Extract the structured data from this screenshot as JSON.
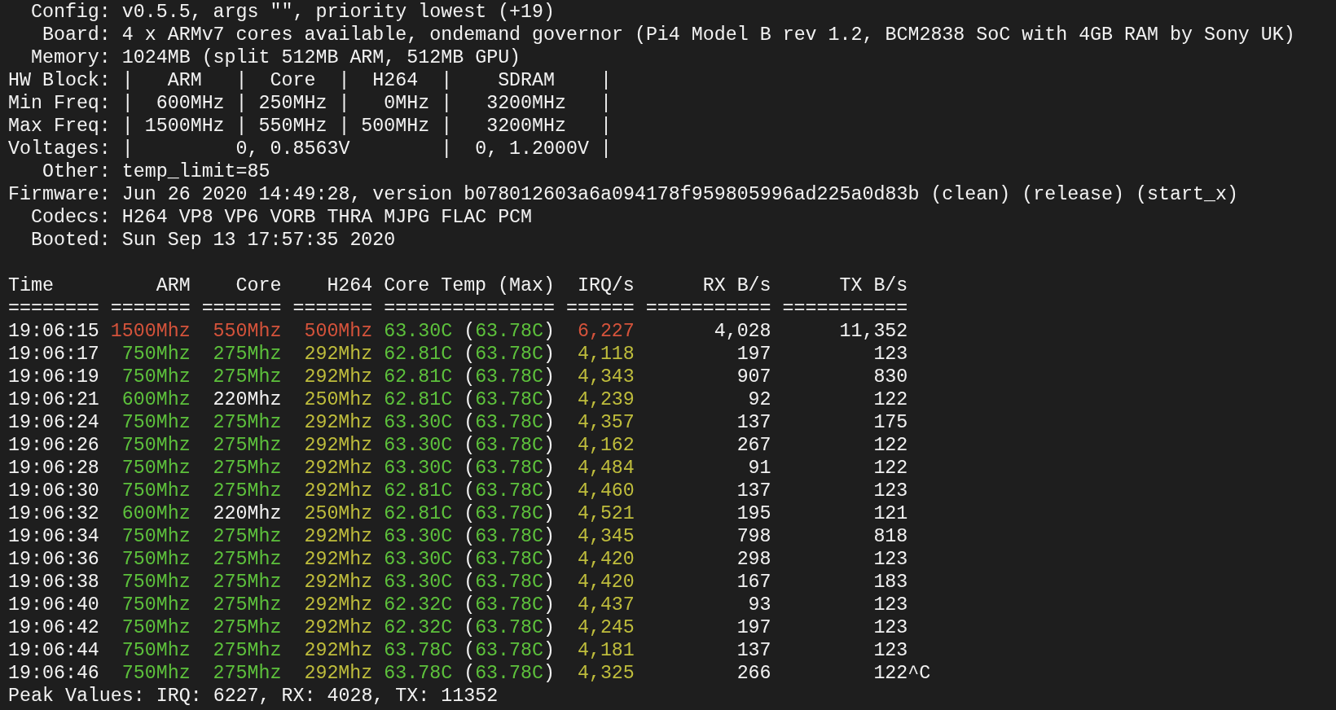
{
  "info_lines": [
    {
      "label": "Config:",
      "value": "v0.5.5, args \"\", priority lowest (+19)"
    },
    {
      "label": "Board:",
      "value": "4 x ARMv7 cores available, ondemand governor (Pi4 Model B rev 1.2, BCM2838 SoC with 4GB RAM by Sony UK)"
    },
    {
      "label": "Memory:",
      "value": "1024MB (split 512MB ARM, 512MB GPU)"
    },
    {
      "label": "HW Block:",
      "value": "|   ARM   |  Core  |  H264  |    SDRAM    |"
    },
    {
      "label": "Min Freq:",
      "value": "|  600MHz | 250MHz |   0MHz |   3200MHz   |"
    },
    {
      "label": "Max Freq:",
      "value": "| 1500MHz | 550MHz | 500MHz |   3200MHz   |"
    },
    {
      "label": "Voltages:",
      "value": "|         0, 0.8563V        |  0, 1.2000V |"
    },
    {
      "label": "Other:",
      "value": "temp_limit=85"
    },
    {
      "label": "Firmware:",
      "value": "Jun 26 2020 14:49:28, version b078012603a6a094178f959805996ad225a0d83b (clean) (release) (start_x)"
    },
    {
      "label": "Codecs:",
      "value": "H264 VP8 VP6 VORB THRA MJPG FLAC PCM"
    },
    {
      "label": "Booted:",
      "value": "Sun Sep 13 17:57:35 2020"
    }
  ],
  "table": {
    "columns": [
      {
        "label": "Time",
        "rule": "========"
      },
      {
        "label": "ARM",
        "rule": "======="
      },
      {
        "label": "Core",
        "rule": "======="
      },
      {
        "label": "H264",
        "rule": "======="
      },
      {
        "label": "Core Temp (Max)",
        "rule": "==============="
      },
      {
        "label": "IRQ/s",
        "rule": "======"
      },
      {
        "label": "RX B/s",
        "rule": "==========="
      },
      {
        "label": "TX B/s",
        "rule": "==========="
      }
    ],
    "rows": [
      {
        "time": "19:06:15",
        "arm": {
          "text": "1500Mhz",
          "color": "#d5533b"
        },
        "core": {
          "text": "550Mhz",
          "color": "#d5533b"
        },
        "h264": {
          "text": "500Mhz",
          "color": "#d5533b"
        },
        "temp": {
          "text": "63.30C",
          "color": "#5dc13c"
        },
        "max": {
          "open": "(",
          "text": "63.78C",
          "close": ")",
          "color": "#5dc13c"
        },
        "irq": {
          "text": "6,227",
          "color": "#d5533b"
        },
        "rx": "4,028",
        "tx": "11,352"
      },
      {
        "time": "19:06:17",
        "arm": {
          "text": "750Mhz",
          "color": "#5dc13c"
        },
        "core": {
          "text": "275Mhz",
          "color": "#5dc13c"
        },
        "h264": {
          "text": "292Mhz",
          "color": "#bfbd3c"
        },
        "temp": {
          "text": "62.81C",
          "color": "#5dc13c"
        },
        "max": {
          "open": "(",
          "text": "63.78C",
          "close": ")",
          "color": "#5dc13c"
        },
        "irq": {
          "text": "4,118",
          "color": "#bfbd3c"
        },
        "rx": "197",
        "tx": "123"
      },
      {
        "time": "19:06:19",
        "arm": {
          "text": "750Mhz",
          "color": "#5dc13c"
        },
        "core": {
          "text": "275Mhz",
          "color": "#5dc13c"
        },
        "h264": {
          "text": "292Mhz",
          "color": "#bfbd3c"
        },
        "temp": {
          "text": "62.81C",
          "color": "#5dc13c"
        },
        "max": {
          "open": "(",
          "text": "63.78C",
          "close": ")",
          "color": "#5dc13c"
        },
        "irq": {
          "text": "4,343",
          "color": "#bfbd3c"
        },
        "rx": "907",
        "tx": "830"
      },
      {
        "time": "19:06:21",
        "arm": {
          "text": "600Mhz",
          "color": "#5dc13c"
        },
        "core": {
          "text": "220Mhz",
          "color": "#f2f2f2"
        },
        "h264": {
          "text": "250Mhz",
          "color": "#bfbd3c"
        },
        "temp": {
          "text": "62.81C",
          "color": "#5dc13c"
        },
        "max": {
          "open": "(",
          "text": "63.78C",
          "close": ")",
          "color": "#5dc13c"
        },
        "irq": {
          "text": "4,239",
          "color": "#bfbd3c"
        },
        "rx": "92",
        "tx": "122"
      },
      {
        "time": "19:06:24",
        "arm": {
          "text": "750Mhz",
          "color": "#5dc13c"
        },
        "core": {
          "text": "275Mhz",
          "color": "#5dc13c"
        },
        "h264": {
          "text": "292Mhz",
          "color": "#bfbd3c"
        },
        "temp": {
          "text": "63.30C",
          "color": "#5dc13c"
        },
        "max": {
          "open": "(",
          "text": "63.78C",
          "close": ")",
          "color": "#5dc13c"
        },
        "irq": {
          "text": "4,357",
          "color": "#bfbd3c"
        },
        "rx": "137",
        "tx": "175"
      },
      {
        "time": "19:06:26",
        "arm": {
          "text": "750Mhz",
          "color": "#5dc13c"
        },
        "core": {
          "text": "275Mhz",
          "color": "#5dc13c"
        },
        "h264": {
          "text": "292Mhz",
          "color": "#bfbd3c"
        },
        "temp": {
          "text": "63.30C",
          "color": "#5dc13c"
        },
        "max": {
          "open": "(",
          "text": "63.78C",
          "close": ")",
          "color": "#5dc13c"
        },
        "irq": {
          "text": "4,162",
          "color": "#bfbd3c"
        },
        "rx": "267",
        "tx": "122"
      },
      {
        "time": "19:06:28",
        "arm": {
          "text": "750Mhz",
          "color": "#5dc13c"
        },
        "core": {
          "text": "275Mhz",
          "color": "#5dc13c"
        },
        "h264": {
          "text": "292Mhz",
          "color": "#bfbd3c"
        },
        "temp": {
          "text": "63.30C",
          "color": "#5dc13c"
        },
        "max": {
          "open": "(",
          "text": "63.78C",
          "close": ")",
          "color": "#5dc13c"
        },
        "irq": {
          "text": "4,484",
          "color": "#bfbd3c"
        },
        "rx": "91",
        "tx": "122"
      },
      {
        "time": "19:06:30",
        "arm": {
          "text": "750Mhz",
          "color": "#5dc13c"
        },
        "core": {
          "text": "275Mhz",
          "color": "#5dc13c"
        },
        "h264": {
          "text": "292Mhz",
          "color": "#bfbd3c"
        },
        "temp": {
          "text": "62.81C",
          "color": "#5dc13c"
        },
        "max": {
          "open": "(",
          "text": "63.78C",
          "close": ")",
          "color": "#5dc13c"
        },
        "irq": {
          "text": "4,460",
          "color": "#bfbd3c"
        },
        "rx": "137",
        "tx": "123"
      },
      {
        "time": "19:06:32",
        "arm": {
          "text": "600Mhz",
          "color": "#5dc13c"
        },
        "core": {
          "text": "220Mhz",
          "color": "#f2f2f2"
        },
        "h264": {
          "text": "250Mhz",
          "color": "#bfbd3c"
        },
        "temp": {
          "text": "62.81C",
          "color": "#5dc13c"
        },
        "max": {
          "open": "(",
          "text": "63.78C",
          "close": ")",
          "color": "#5dc13c"
        },
        "irq": {
          "text": "4,521",
          "color": "#bfbd3c"
        },
        "rx": "195",
        "tx": "121"
      },
      {
        "time": "19:06:34",
        "arm": {
          "text": "750Mhz",
          "color": "#5dc13c"
        },
        "core": {
          "text": "275Mhz",
          "color": "#5dc13c"
        },
        "h264": {
          "text": "292Mhz",
          "color": "#bfbd3c"
        },
        "temp": {
          "text": "63.30C",
          "color": "#5dc13c"
        },
        "max": {
          "open": "(",
          "text": "63.78C",
          "close": ")",
          "color": "#5dc13c"
        },
        "irq": {
          "text": "4,345",
          "color": "#bfbd3c"
        },
        "rx": "798",
        "tx": "818"
      },
      {
        "time": "19:06:36",
        "arm": {
          "text": "750Mhz",
          "color": "#5dc13c"
        },
        "core": {
          "text": "275Mhz",
          "color": "#5dc13c"
        },
        "h264": {
          "text": "292Mhz",
          "color": "#bfbd3c"
        },
        "temp": {
          "text": "63.30C",
          "color": "#5dc13c"
        },
        "max": {
          "open": "(",
          "text": "63.78C",
          "close": ")",
          "color": "#5dc13c"
        },
        "irq": {
          "text": "4,420",
          "color": "#bfbd3c"
        },
        "rx": "298",
        "tx": "123"
      },
      {
        "time": "19:06:38",
        "arm": {
          "text": "750Mhz",
          "color": "#5dc13c"
        },
        "core": {
          "text": "275Mhz",
          "color": "#5dc13c"
        },
        "h264": {
          "text": "292Mhz",
          "color": "#bfbd3c"
        },
        "temp": {
          "text": "63.30C",
          "color": "#5dc13c"
        },
        "max": {
          "open": "(",
          "text": "63.78C",
          "close": ")",
          "color": "#5dc13c"
        },
        "irq": {
          "text": "4,420",
          "color": "#bfbd3c"
        },
        "rx": "167",
        "tx": "183"
      },
      {
        "time": "19:06:40",
        "arm": {
          "text": "750Mhz",
          "color": "#5dc13c"
        },
        "core": {
          "text": "275Mhz",
          "color": "#5dc13c"
        },
        "h264": {
          "text": "292Mhz",
          "color": "#bfbd3c"
        },
        "temp": {
          "text": "62.32C",
          "color": "#5dc13c"
        },
        "max": {
          "open": "(",
          "text": "63.78C",
          "close": ")",
          "color": "#5dc13c"
        },
        "irq": {
          "text": "4,437",
          "color": "#bfbd3c"
        },
        "rx": "93",
        "tx": "123"
      },
      {
        "time": "19:06:42",
        "arm": {
          "text": "750Mhz",
          "color": "#5dc13c"
        },
        "core": {
          "text": "275Mhz",
          "color": "#5dc13c"
        },
        "h264": {
          "text": "292Mhz",
          "color": "#bfbd3c"
        },
        "temp": {
          "text": "62.32C",
          "color": "#5dc13c"
        },
        "max": {
          "open": "(",
          "text": "63.78C",
          "close": ")",
          "color": "#5dc13c"
        },
        "irq": {
          "text": "4,245",
          "color": "#bfbd3c"
        },
        "rx": "197",
        "tx": "123"
      },
      {
        "time": "19:06:44",
        "arm": {
          "text": "750Mhz",
          "color": "#5dc13c"
        },
        "core": {
          "text": "275Mhz",
          "color": "#5dc13c"
        },
        "h264": {
          "text": "292Mhz",
          "color": "#bfbd3c"
        },
        "temp": {
          "text": "63.78C",
          "color": "#5dc13c"
        },
        "max": {
          "open": "(",
          "text": "63.78C",
          "close": ")",
          "color": "#5dc13c"
        },
        "irq": {
          "text": "4,181",
          "color": "#bfbd3c"
        },
        "rx": "137",
        "tx": "123"
      },
      {
        "time": "19:06:46",
        "arm": {
          "text": "750Mhz",
          "color": "#5dc13c"
        },
        "core": {
          "text": "275Mhz",
          "color": "#5dc13c"
        },
        "h264": {
          "text": "292Mhz",
          "color": "#bfbd3c"
        },
        "temp": {
          "text": "63.78C",
          "color": "#5dc13c"
        },
        "max": {
          "open": "(",
          "text": "63.78C",
          "close": ")",
          "color": "#5dc13c"
        },
        "irq": {
          "text": "4,325",
          "color": "#bfbd3c"
        },
        "rx": "266",
        "tx": "122",
        "trailer": "^C"
      }
    ]
  },
  "summary": "Peak Values: IRQ: 6227, RX: 4028, TX: 11352"
}
